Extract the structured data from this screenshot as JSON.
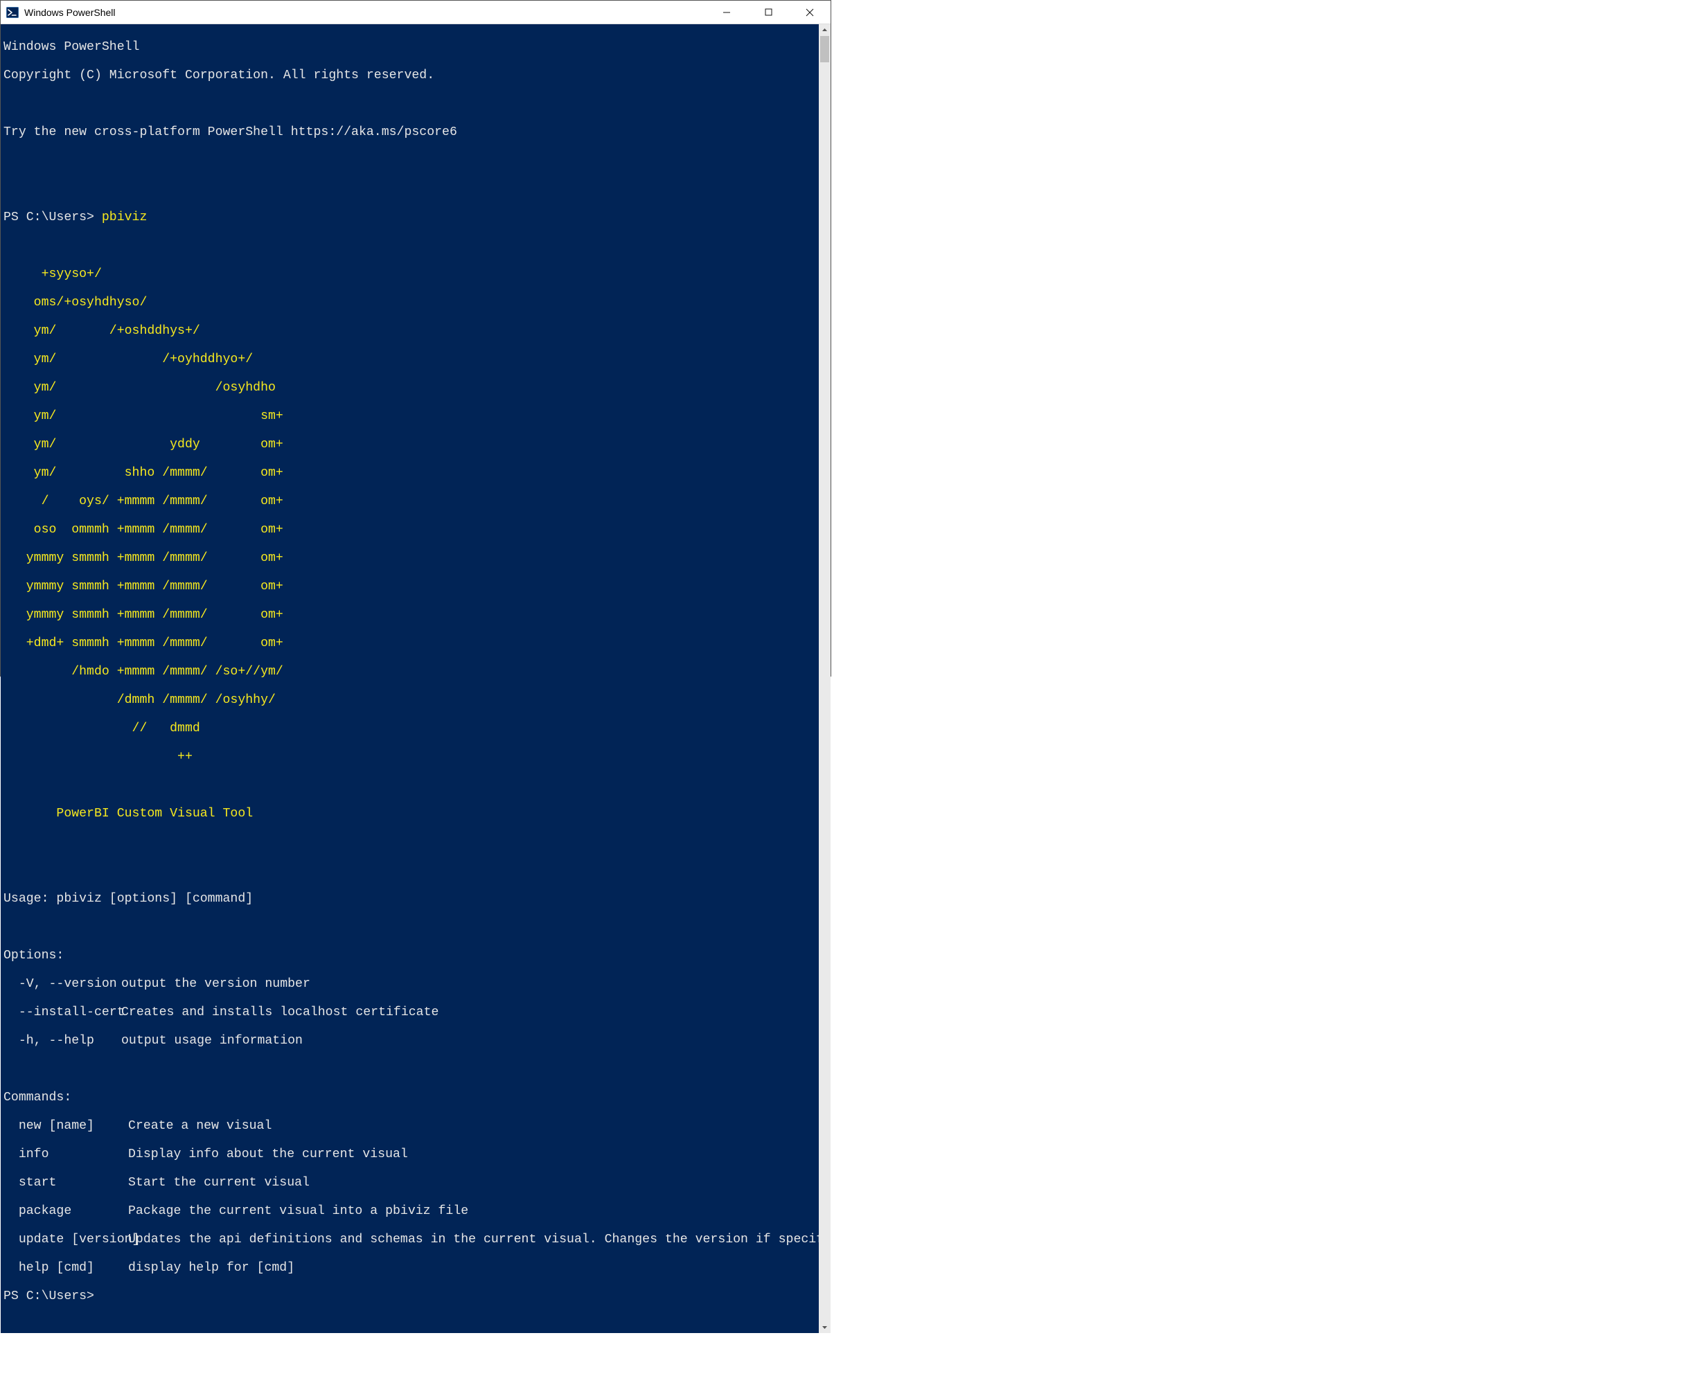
{
  "window": {
    "title": "Windows PowerShell"
  },
  "banner": {
    "line1": "Windows PowerShell",
    "line2": "Copyright (C) Microsoft Corporation. All rights reserved.",
    "line3": "Try the new cross-platform PowerShell https://aka.ms/pscore6"
  },
  "prompt": {
    "prefix": "PS C:\\Users> ",
    "command": "pbiviz",
    "final": "PS C:\\Users>"
  },
  "ascii": {
    "l0": "     +syyso+/",
    "l1": "    oms/+osyhdhyso/",
    "l2": "    ym/       /+oshddhys+/",
    "l3": "    ym/              /+oyhddhyo+/",
    "l4": "    ym/                     /osyhdho",
    "l5": "    ym/                           sm+",
    "l6": "    ym/               yddy        om+",
    "l7": "    ym/         shho /mmmm/       om+",
    "l8": "     /    oys/ +mmmm /mmmm/       om+",
    "l9": "    oso  ommmh +mmmm /mmmm/       om+",
    "l10": "   ymmmy smmmh +mmmm /mmmm/       om+",
    "l11": "   ymmmy smmmh +mmmm /mmmm/       om+",
    "l12": "   ymmmy smmmh +mmmm /mmmm/       om+",
    "l13": "   +dmd+ smmmh +mmmm /mmmm/       om+",
    "l14": "         /hmdo +mmmm /mmmm/ /so+//ym/",
    "l15": "               /dmmh /mmmm/ /osyhhy/",
    "l16": "                 //   dmmd",
    "l17": "                       ++",
    "tool": "       PowerBI Custom Visual Tool"
  },
  "usage": "Usage: pbiviz [options] [command]",
  "optionsHeader": "Options:",
  "options": [
    {
      "flag": "  -V, --version",
      "desc": "output the version number"
    },
    {
      "flag": "  --install-cert",
      "desc": "Creates and installs localhost certificate"
    },
    {
      "flag": "  -h, --help",
      "desc": "output usage information"
    }
  ],
  "commandsHeader": "Commands:",
  "commands": [
    {
      "name": "  new [name]",
      "desc": "Create a new visual"
    },
    {
      "name": "  info",
      "desc": "Display info about the current visual"
    },
    {
      "name": "  start",
      "desc": "Start the current visual"
    },
    {
      "name": "  package",
      "desc": "Package the current visual into a pbiviz file"
    },
    {
      "name": "  update [version]",
      "desc": "Updates the api definitions and schemas in the current visual. Changes the version if specified"
    },
    {
      "name": "  help [cmd]",
      "desc": "display help for [cmd]"
    }
  ]
}
